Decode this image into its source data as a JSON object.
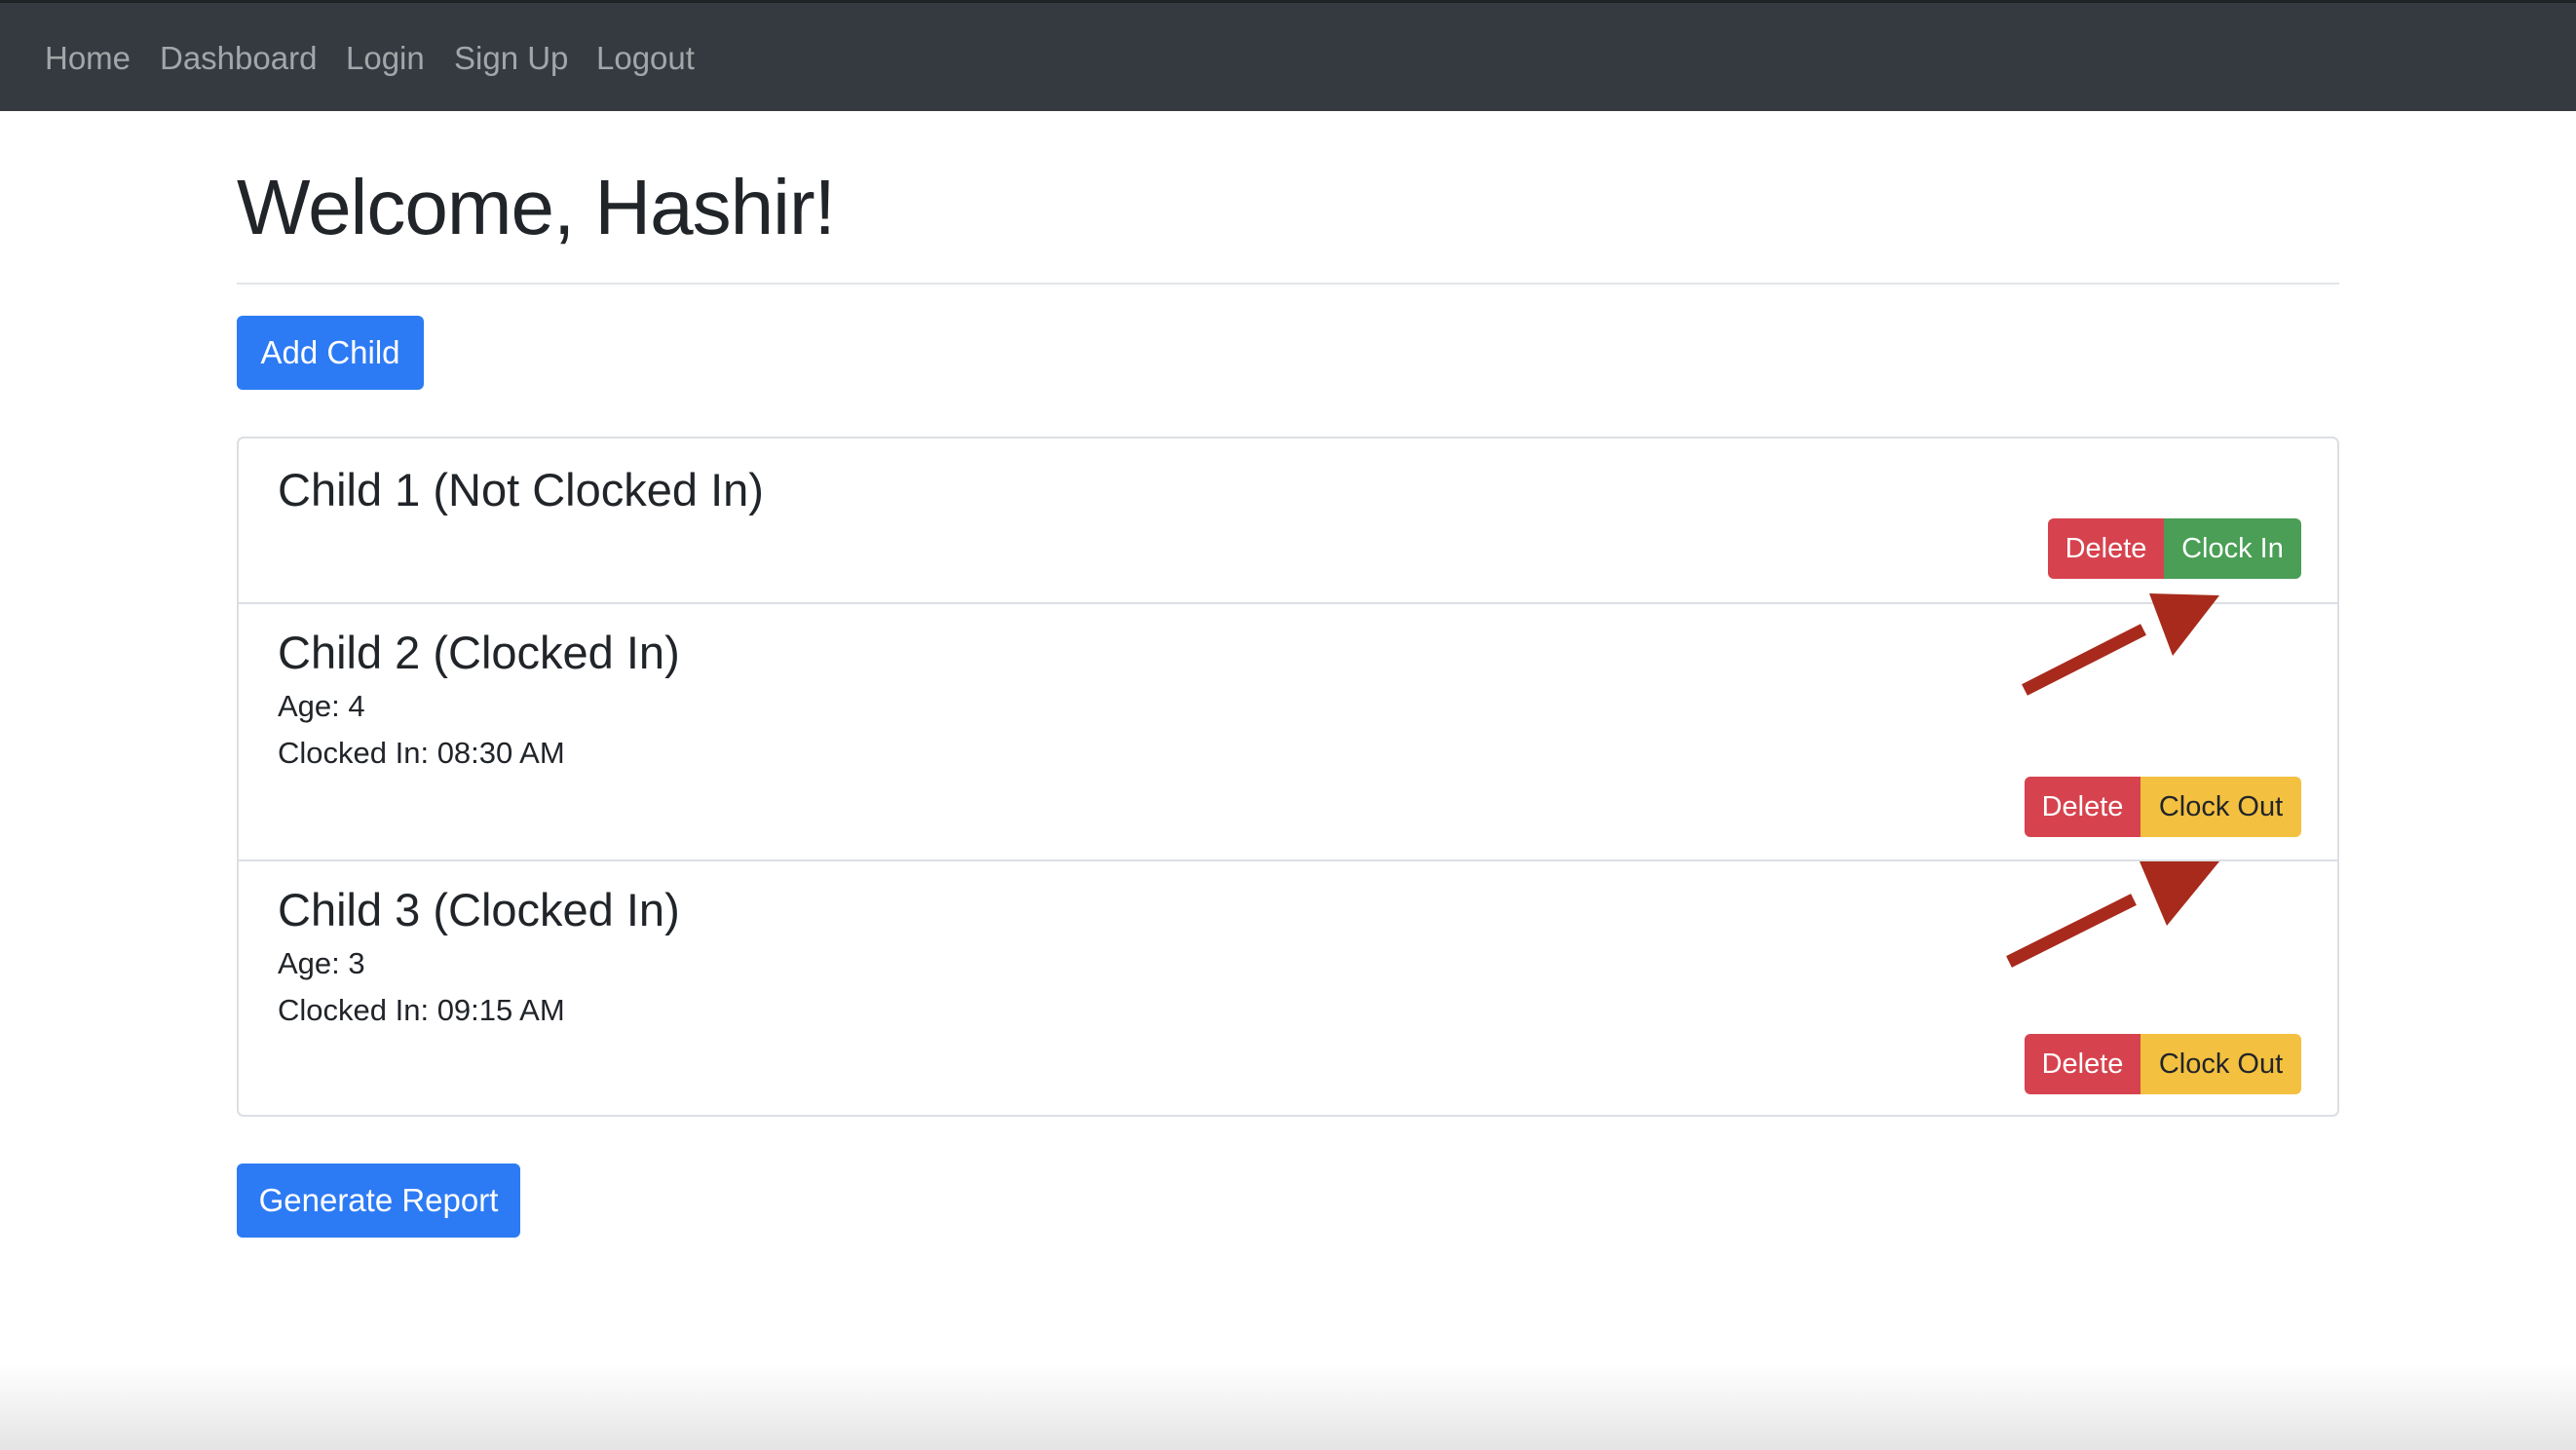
{
  "nav": {
    "items": [
      {
        "label": "Home"
      },
      {
        "label": "Dashboard"
      },
      {
        "label": "Login"
      },
      {
        "label": "Sign Up"
      },
      {
        "label": "Logout"
      }
    ]
  },
  "page": {
    "title": "Welcome, Hashir!",
    "add_child_label": "Add Child",
    "generate_report_label": "Generate Report"
  },
  "children": [
    {
      "name": "Child 1 (Not Clocked In)",
      "delete_label": "Delete",
      "action_label": "Clock In"
    },
    {
      "name": "Child 2 (Clocked In)",
      "age_text": "Age: 4",
      "clocked_in_text": "Clocked In: 08:30 AM",
      "delete_label": "Delete",
      "action_label": "Clock Out"
    },
    {
      "name": "Child 3 (Clocked In)",
      "age_text": "Age: 3",
      "clocked_in_text": "Clocked In: 09:15 AM",
      "delete_label": "Delete",
      "action_label": "Clock Out"
    }
  ],
  "colors": {
    "navbar": "#343a40",
    "primary": "#2d7bf4",
    "danger": "#d6434f",
    "success": "#4a9e55",
    "warning": "#f4c03f",
    "annotation_arrow": "#a82a1c"
  }
}
